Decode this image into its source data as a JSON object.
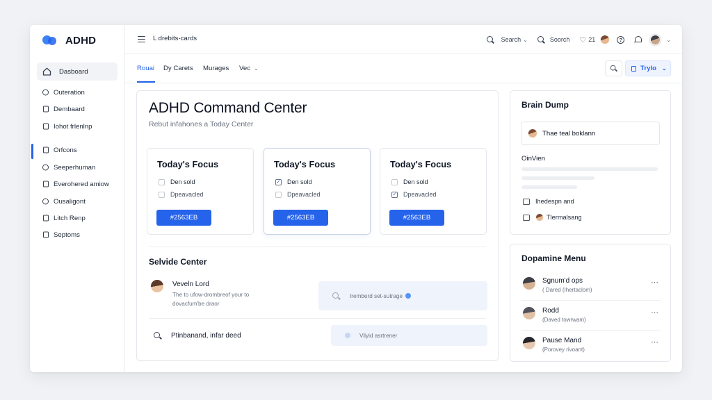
{
  "brand": {
    "name": "ADHD"
  },
  "sidebar": {
    "items": [
      {
        "label": "Dasboard",
        "icon": "home-icon"
      },
      {
        "label": "Outeration",
        "icon": "circle-icon"
      },
      {
        "label": "Dembaard",
        "icon": "square-icon"
      },
      {
        "label": "Iohot frlenlnp",
        "icon": "square-icon"
      },
      {
        "label": "Orfcons",
        "icon": "square-icon"
      },
      {
        "label": "Seeperhuman",
        "icon": "circle-icon"
      },
      {
        "label": "Everohered amiow",
        "icon": "square-icon"
      },
      {
        "label": "Ousaligont",
        "icon": "circle-icon"
      },
      {
        "label": "Litch Renp",
        "icon": "square-icon"
      },
      {
        "label": "Septoms",
        "icon": "square-icon"
      }
    ]
  },
  "topbar": {
    "breadcrumb": "L drebits-cards",
    "search1": "Search",
    "search2": "Soorch",
    "count": "21"
  },
  "tabs": {
    "items": [
      "Rouai",
      "Dy Carets",
      "Murages",
      "Vec"
    ],
    "select_label": "Trylo"
  },
  "main": {
    "title": "ADHD Command Center",
    "subtitle": "Rebut infahones a Today Center",
    "focus_cards": [
      {
        "title": "Today's Focus",
        "items": [
          {
            "label": "Den sold",
            "checked": false
          },
          {
            "label": "Dpeavacled",
            "checked": false
          }
        ],
        "button": "#2563EB"
      },
      {
        "title": "Today's Focus",
        "items": [
          {
            "label": "Den sold",
            "checked": true
          },
          {
            "label": "Dpeavacled",
            "checked": false
          }
        ],
        "button": "#2563EB"
      },
      {
        "title": "Today's Focus",
        "items": [
          {
            "label": "Den sold",
            "checked": false
          },
          {
            "label": "Dpeavacled",
            "checked": true
          }
        ],
        "button": "#2563EB"
      }
    ],
    "section_title": "Selvide Center",
    "person": {
      "name": "Veveln Lord",
      "desc": "The to ufow-drombreof your to dovacfum'be draor"
    },
    "ghost1": "Iremberd set-sutrage",
    "search_row": "Ptinbanand, infar deed",
    "ghost2": "Vilyid asrtrener"
  },
  "brain_dump": {
    "title": "Brain Dump",
    "input_value": "Thae teal boklann",
    "label": "OinVien",
    "items": [
      "Ihedespn and",
      "Tlermalsang"
    ]
  },
  "dopamine": {
    "title": "Dopamine Menu",
    "items": [
      {
        "name": "Sgnum'd ops",
        "sub": "( Dared (Ihertaclom)"
      },
      {
        "name": "Rodd",
        "sub": "(Daved towrwam)"
      },
      {
        "name": "Pause Mand",
        "sub": "(Porovey rivoant)"
      }
    ]
  },
  "colors": {
    "accent": "#2563EB",
    "text": "#111827",
    "muted": "#6B7280",
    "border": "#E3E6EB"
  }
}
